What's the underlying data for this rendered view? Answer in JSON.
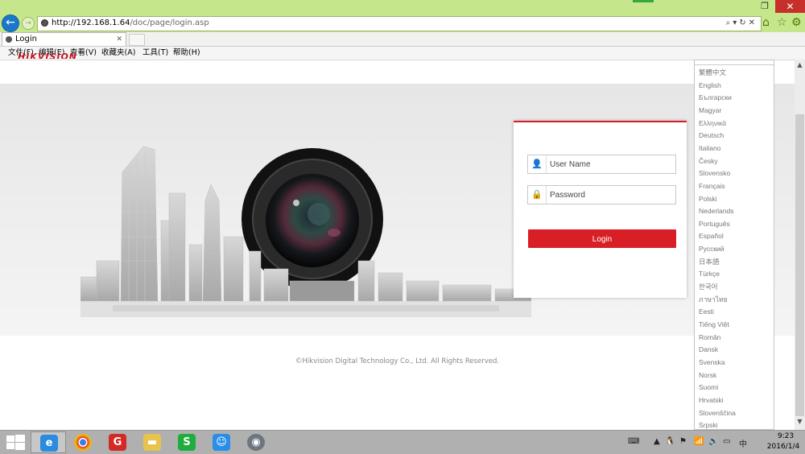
{
  "browser": {
    "url_host": "http://192.168.1.64",
    "url_path": "/doc/page/login.asp",
    "tab_title": "Login",
    "menu": [
      "文件(F)",
      "编辑(E)",
      "查看(V)",
      "收藏夹(A)",
      "工具(T)",
      "帮助(H)"
    ]
  },
  "login": {
    "username_placeholder": "User Name",
    "password_placeholder": "Password",
    "button_label": "Login"
  },
  "footer": "©Hikvision Digital Technology Co., Ltd. All Rights Reserved.",
  "logo_text": "HIKVISION",
  "languages": [
    "繁體中文",
    "English",
    "Български",
    "Magyar",
    "Ελληνικά",
    "Deutsch",
    "Italiano",
    "Česky",
    "Slovensko",
    "Français",
    "Polski",
    "Nederlands",
    "Português",
    "Español",
    "Русский",
    "日本語",
    "Türkçe",
    "한국어",
    "ภาษาไทย",
    "Eesti",
    "Tiếng Việt",
    "Român",
    "Dansk",
    "Svenska",
    "Norsk",
    "Suomi",
    "Hrvatski",
    "Slovenščina",
    "Srpski"
  ],
  "taskbar": {
    "time": "9:23",
    "date": "2016/1/4"
  },
  "colors": {
    "brand_red": "#d91f26",
    "chrome_green": "#c6e68b"
  }
}
